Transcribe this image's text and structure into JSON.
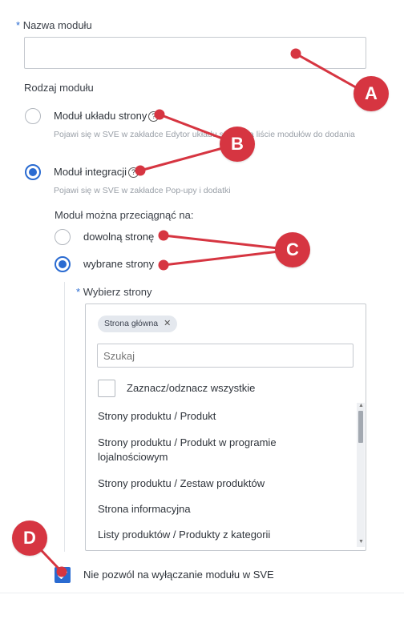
{
  "module_name": {
    "required_mark": "*",
    "label": "Nazwa modułu",
    "value": "",
    "placeholder": ""
  },
  "module_type": {
    "label": "Rodzaj modułu",
    "options": [
      {
        "label": "Moduł układu strony",
        "hint": "Pojawi się w SVE w zakładce Edytor układu strony na liście modułów do dodania",
        "selected": false
      },
      {
        "label": "Moduł integracji",
        "hint": "Pojawi się w SVE w zakładce Pop-upy i dodatki",
        "selected": true
      }
    ],
    "help_glyph": "?"
  },
  "drag_target": {
    "label": "Moduł można przeciągnąć na:",
    "options": [
      {
        "label": "dowolną stronę",
        "selected": false
      },
      {
        "label": "wybrane strony",
        "selected": true
      }
    ]
  },
  "select_pages": {
    "required_mark": "*",
    "label": "Wybierz strony",
    "selected_tag": "Strona główna",
    "tag_remove_glyph": "✕",
    "search_placeholder": "Szukaj",
    "select_all_label": "Zaznacz/odznacz wszystkie",
    "items": [
      "Strony produktu / Produkt",
      "Strony produktu / Produkt w programie lojalnościowym",
      "Strony produktu / Zestaw produktów",
      "Strona informacyjna",
      "Listy produktów / Produkty z kategorii"
    ]
  },
  "no_disable": {
    "label": "Nie pozwól na wyłączanie modułu w SVE",
    "checked": true
  },
  "markers": [
    "A",
    "B",
    "C",
    "D"
  ],
  "colors": {
    "accent": "#2a6bd1",
    "marker": "#d63541"
  }
}
